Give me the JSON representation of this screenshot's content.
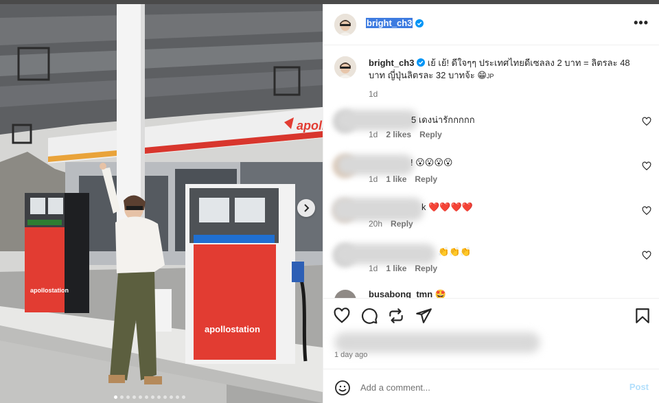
{
  "header": {
    "username": "bright_ch3",
    "verified": true,
    "more_icon": "more-options-icon",
    "more_label": "•••"
  },
  "caption": {
    "username": "bright_ch3",
    "text": "เย้ เย้! ดีใจๆๆ ประเทศไทยดีเซลลง 2 บาท = ลิตรละ 48 บาท ญี่ปุ่นลิตรละ 32 บาทจ้ะ",
    "emoji": "😁",
    "suffix": "JP",
    "time": "1d"
  },
  "comments": [
    {
      "text": "5 เดงน่ารักกกกก",
      "time": "1d",
      "likes": "2 likes",
      "reply": "Reply"
    },
    {
      "text": "! 😮😮😮😮",
      "time": "1d",
      "likes": "1 like",
      "reply": "Reply"
    },
    {
      "text": "k ❤️❤️❤️❤️",
      "time": "20h",
      "likes": "",
      "reply": "Reply"
    },
    {
      "text": "👏👏👏",
      "time": "1d",
      "likes": "1 like",
      "reply": "Reply"
    }
  ],
  "partial_comment": {
    "username": "busabong_tmn",
    "emoji": "🤩"
  },
  "actions": {
    "like_icon": "heart-icon",
    "comment_icon": "comment-icon",
    "share_icon": "repost-icon",
    "send_icon": "send-icon",
    "save_icon": "bookmark-icon"
  },
  "post_time": "1 day ago",
  "add_comment": {
    "emoji_icon": "emoji-icon",
    "placeholder": "Add a comment...",
    "post_label": "Post"
  },
  "photo": {
    "brand_sign": "apollo",
    "pump_brand": "apollostation",
    "pump_brand_small": "apollostation",
    "carousel_next_icon": "chevron-right-icon",
    "dots_count": 12
  },
  "colors": {
    "accent": "#0095f6",
    "post_disabled": "#b2dffc",
    "verified": "#0095f6",
    "pump_red": "#e23c32"
  }
}
